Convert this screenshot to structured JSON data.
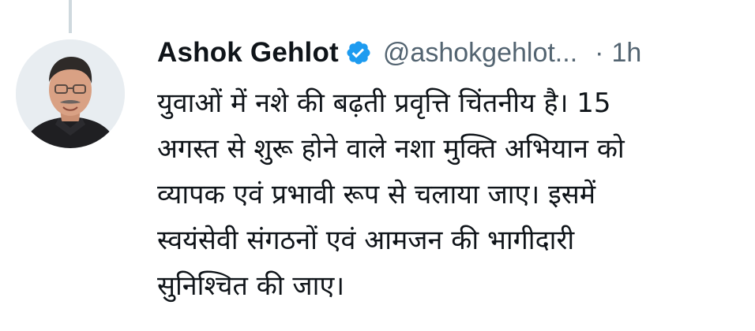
{
  "tweet": {
    "author_name": "Ashok Gehlot",
    "handle": "@ashokgehlot...",
    "separator": "·",
    "time": "1h",
    "text": "युवाओं में नशे की बढ़ती प्रवृत्ति चिंतनीय है। 15\nअगस्त से शुरू होने वाले नशा मुक्ति अभियान को\nव्यापक एवं प्रभावी रूप से चलाया जाए। इसमें\nस्वयंसेवी संगठनों एवं आमजन की भागीदारी\nसुनिश्चित की जाए।",
    "avatar_icon": "profile-photo",
    "verified_icon": "verified-badge-icon",
    "colors": {
      "text": "#0f1419",
      "secondary": "#536471",
      "verified": "#1d9bf0",
      "thread_line": "#cfd9de"
    }
  }
}
